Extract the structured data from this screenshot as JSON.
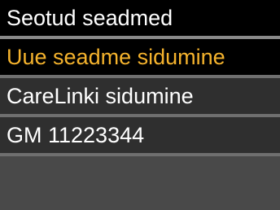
{
  "header": {
    "title": "Seotud seadmed"
  },
  "menu": {
    "items": [
      {
        "label": "Uue seadme sidumine",
        "selected": true
      },
      {
        "label": "CareLinki sidumine",
        "selected": false
      },
      {
        "label": "GM 11223344",
        "selected": false
      }
    ]
  },
  "colors": {
    "selected_text": "#f5b32d",
    "text": "#ffffff",
    "background": "#000000",
    "item_background": "#2f2f2f",
    "empty_background": "#494949"
  }
}
